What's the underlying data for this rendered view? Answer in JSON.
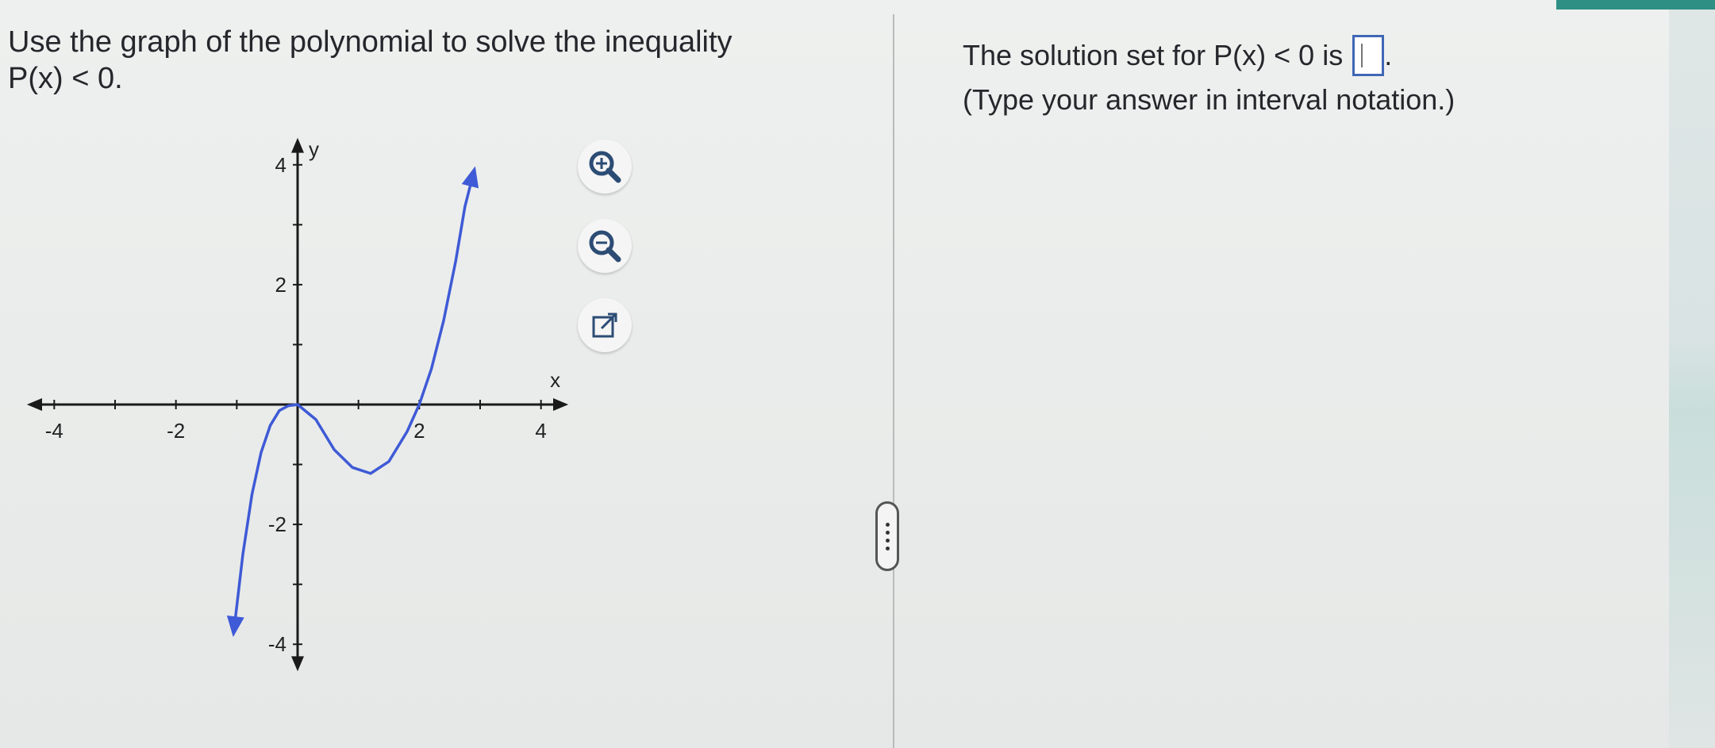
{
  "question": {
    "line1": "Use the graph of the polynomial to solve the inequality",
    "line2": "P(x) < 0."
  },
  "answer_panel": {
    "prompt": "The solution set for P(x) < 0 is",
    "answer_value": "",
    "punctuation": ".",
    "instruction": "(Type your answer in interval notation.)"
  },
  "graph_tools": {
    "zoom_in": "zoom-in-icon",
    "zoom_out": "zoom-out-icon",
    "open_external": "external-link-icon"
  },
  "colors": {
    "curve": "#3e5ad6",
    "axis": "#1a1a1a",
    "answer_border": "#3f67b5"
  },
  "chart_data": {
    "type": "line",
    "title": "",
    "xlabel": "x",
    "ylabel": "y",
    "xlim": [
      -4.5,
      4.5
    ],
    "ylim": [
      -4.5,
      4.5
    ],
    "x_ticks": [
      -4,
      -2,
      2,
      4
    ],
    "y_ticks": [
      4,
      2,
      -2,
      -4
    ],
    "x_tick_labels": [
      "-4",
      "-2",
      "2",
      "4"
    ],
    "y_tick_labels": [
      "4",
      "2",
      "-2",
      "-4"
    ],
    "grid": false,
    "series": [
      {
        "points": [
          [
            -1.05,
            -3.8
          ],
          [
            -0.9,
            -2.5
          ],
          [
            -0.75,
            -1.5
          ],
          [
            -0.6,
            -0.8
          ],
          [
            -0.45,
            -0.35
          ],
          [
            -0.3,
            -0.1
          ],
          [
            -0.15,
            -0.02
          ],
          [
            0,
            0
          ],
          [
            0.3,
            -0.25
          ],
          [
            0.6,
            -0.75
          ],
          [
            0.9,
            -1.05
          ],
          [
            1.2,
            -1.15
          ],
          [
            1.5,
            -0.95
          ],
          [
            1.8,
            -0.45
          ],
          [
            2.0,
            0.0
          ],
          [
            2.2,
            0.6
          ],
          [
            2.4,
            1.4
          ],
          [
            2.6,
            2.4
          ],
          [
            2.75,
            3.3
          ],
          [
            2.9,
            3.9
          ]
        ]
      }
    ],
    "key_points": [
      {
        "x": 0,
        "y": 0
      },
      {
        "x": 1.3,
        "y": -1.15
      },
      {
        "x": 2,
        "y": 0
      }
    ]
  }
}
